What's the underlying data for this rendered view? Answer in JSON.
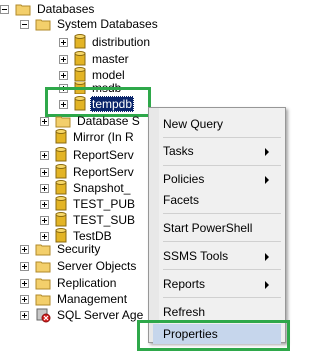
{
  "tree": {
    "databases_label": "Databases",
    "system_databases_label": "System Databases",
    "system_dbs": [
      "distribution",
      "master",
      "model",
      "msdb"
    ],
    "selected_db": "tempdb",
    "database_snapshots_label": "Database S",
    "user_dbs": [
      "Mirror (In R",
      "ReportServ",
      "ReportServ",
      "Snapshot_",
      "TEST_PUB",
      "TEST_SUB",
      "TestDB"
    ],
    "other_nodes": [
      "Security",
      "Server Objects",
      "Replication",
      "Management",
      "SQL Server Age"
    ]
  },
  "context_menu": {
    "items": [
      {
        "label": "New Query",
        "submenu": false
      },
      {
        "label": "Tasks",
        "submenu": true
      },
      {
        "label": "Policies",
        "submenu": true
      },
      {
        "label": "Facets",
        "submenu": false
      },
      {
        "label": "Start PowerShell",
        "submenu": false
      },
      {
        "label": "SSMS Tools",
        "submenu": true
      },
      {
        "label": "Reports",
        "submenu": true
      },
      {
        "label": "Refresh",
        "submenu": false
      },
      {
        "label": "Properties",
        "submenu": false,
        "hovered": true
      }
    ]
  },
  "colors": {
    "highlight_green": "#2ea84a",
    "selection_blue": "#0a246a",
    "hover_blue": "#c6d6ec",
    "folder_yellow": "#f3cf6b",
    "database_gold": "#e3b425"
  }
}
